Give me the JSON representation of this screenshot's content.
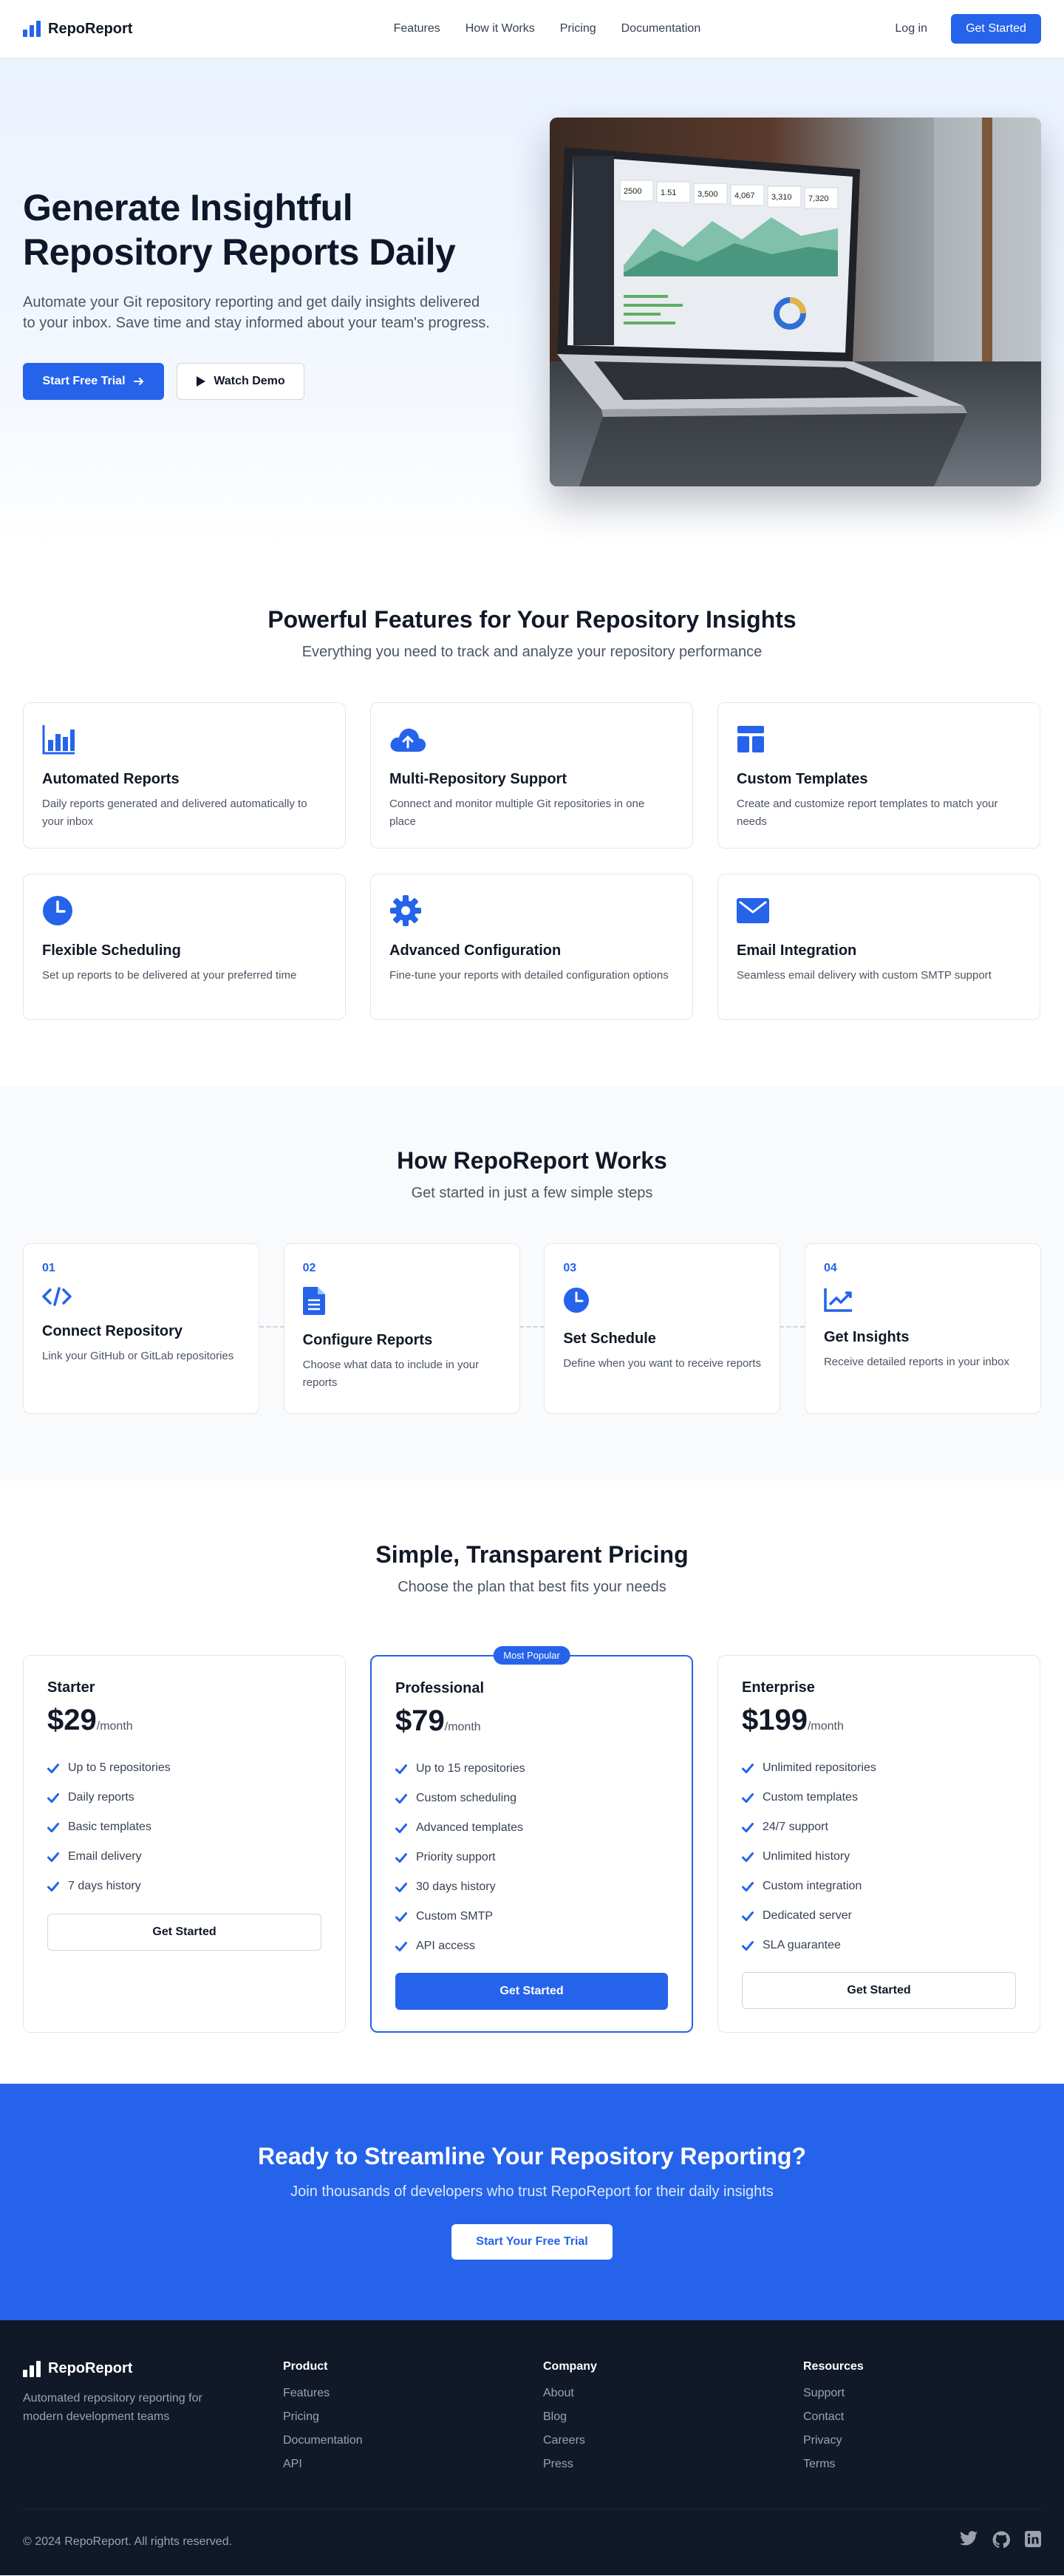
{
  "nav": {
    "brand": "RepoReport",
    "links": [
      "Features",
      "How it Works",
      "Pricing",
      "Documentation"
    ],
    "login": "Log in",
    "cta": "Get Started"
  },
  "hero": {
    "title_line1": "Generate Insightful",
    "title_line2": "Repository Reports Daily",
    "description": "Automate your Git repository reporting and get daily insights delivered to your inbox. Save time and stay informed about your team's progress.",
    "primary_button": "Start Free Trial",
    "secondary_button": "Watch Demo",
    "stats": [
      "2500",
      "1.51",
      "3,500",
      "4,067",
      "3,310",
      "7,320"
    ]
  },
  "features": {
    "title": "Powerful Features for Your Repository Insights",
    "subtitle": "Everything you need to track and analyze your repository performance",
    "items": [
      {
        "icon": "bar-chart-icon",
        "title": "Automated Reports",
        "description": "Daily reports generated and delivered automatically to your inbox"
      },
      {
        "icon": "cloud-upload-icon",
        "title": "Multi-Repository Support",
        "description": "Connect and monitor multiple Git repositories in one place"
      },
      {
        "icon": "layout-template-icon",
        "title": "Custom Templates",
        "description": "Create and customize report templates to match your needs"
      },
      {
        "icon": "clock-icon",
        "title": "Flexible Scheduling",
        "description": "Set up reports to be delivered at your preferred time"
      },
      {
        "icon": "gear-icon",
        "title": "Advanced Configuration",
        "description": "Fine-tune your reports with detailed configuration options"
      },
      {
        "icon": "envelope-icon",
        "title": "Email Integration",
        "description": "Seamless email delivery with custom SMTP support"
      }
    ]
  },
  "how": {
    "title": "How RepoReport Works",
    "subtitle": "Get started in just a few simple steps",
    "steps": [
      {
        "num": "01",
        "icon": "code-icon",
        "title": "Connect Repository",
        "description": "Link your GitHub or GitLab repositories"
      },
      {
        "num": "02",
        "icon": "document-icon",
        "title": "Configure Reports",
        "description": "Choose what data to include in your reports"
      },
      {
        "num": "03",
        "icon": "clock-icon",
        "title": "Set Schedule",
        "description": "Define when you want to receive reports"
      },
      {
        "num": "04",
        "icon": "trending-chart-icon",
        "title": "Get Insights",
        "description": "Receive detailed reports in your inbox"
      }
    ]
  },
  "pricing": {
    "title": "Simple, Transparent Pricing",
    "subtitle": "Choose the plan that best fits your needs",
    "badge": "Most Popular",
    "period": "/month",
    "plans": [
      {
        "name": "Starter",
        "price": "$29",
        "features": [
          "Up to 5 repositories",
          "Daily reports",
          "Basic templates",
          "Email delivery",
          "7 days history"
        ],
        "cta": "Get Started"
      },
      {
        "name": "Professional",
        "price": "$79",
        "features": [
          "Up to 15 repositories",
          "Custom scheduling",
          "Advanced templates",
          "Priority support",
          "30 days history",
          "Custom SMTP",
          "API access"
        ],
        "cta": "Get Started"
      },
      {
        "name": "Enterprise",
        "price": "$199",
        "features": [
          "Unlimited repositories",
          "Custom templates",
          "24/7 support",
          "Unlimited history",
          "Custom integration",
          "Dedicated server",
          "SLA guarantee"
        ],
        "cta": "Get Started"
      }
    ]
  },
  "cta_band": {
    "title": "Ready to Streamline Your Repository Reporting?",
    "subtitle": "Join thousands of developers who trust RepoReport for their daily insights",
    "button": "Start Your Free Trial"
  },
  "footer": {
    "brand": "RepoReport",
    "description": "Automated repository reporting for modern development teams",
    "columns": [
      {
        "title": "Product",
        "links": [
          "Features",
          "Pricing",
          "Documentation",
          "API"
        ]
      },
      {
        "title": "Company",
        "links": [
          "About",
          "Blog",
          "Careers",
          "Press"
        ]
      },
      {
        "title": "Resources",
        "links": [
          "Support",
          "Contact",
          "Privacy",
          "Terms"
        ]
      }
    ],
    "copyright": "© 2024 RepoReport. All rights reserved.",
    "social": [
      "twitter-icon",
      "github-icon",
      "linkedin-icon"
    ]
  },
  "colors": {
    "accent": "#2563eb",
    "footer_bg": "#111827",
    "how_bg": "#f9fafb"
  }
}
